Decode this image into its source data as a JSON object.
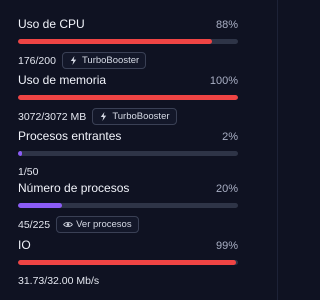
{
  "metrics": [
    {
      "label": "Uso de CPU",
      "percent_text": "88%",
      "percent": 88,
      "value_text": "176/200",
      "bar_color": "#ef4444",
      "action": {
        "label": "TurboBooster",
        "icon": "bolt-icon"
      }
    },
    {
      "label": "Uso de memoria",
      "percent_text": "100%",
      "percent": 100,
      "value_text": "3072/3072 MB",
      "bar_color": "#ef4444",
      "action": {
        "label": "TurboBooster",
        "icon": "bolt-icon"
      }
    },
    {
      "label": "Procesos entrantes",
      "percent_text": "2%",
      "percent": 2,
      "value_text": "1/50",
      "bar_color": "#8b5cf6"
    },
    {
      "label": "Número de procesos",
      "percent_text": "20%",
      "percent": 20,
      "value_text": "45/225",
      "bar_color": "#8b5cf6",
      "action": {
        "label": "Ver procesos",
        "icon": "eye-icon"
      }
    },
    {
      "label": "IO",
      "percent_text": "99%",
      "percent": 99,
      "value_text": "31.73/32.00 Mb/s",
      "bar_color": "#ef4444"
    }
  ]
}
